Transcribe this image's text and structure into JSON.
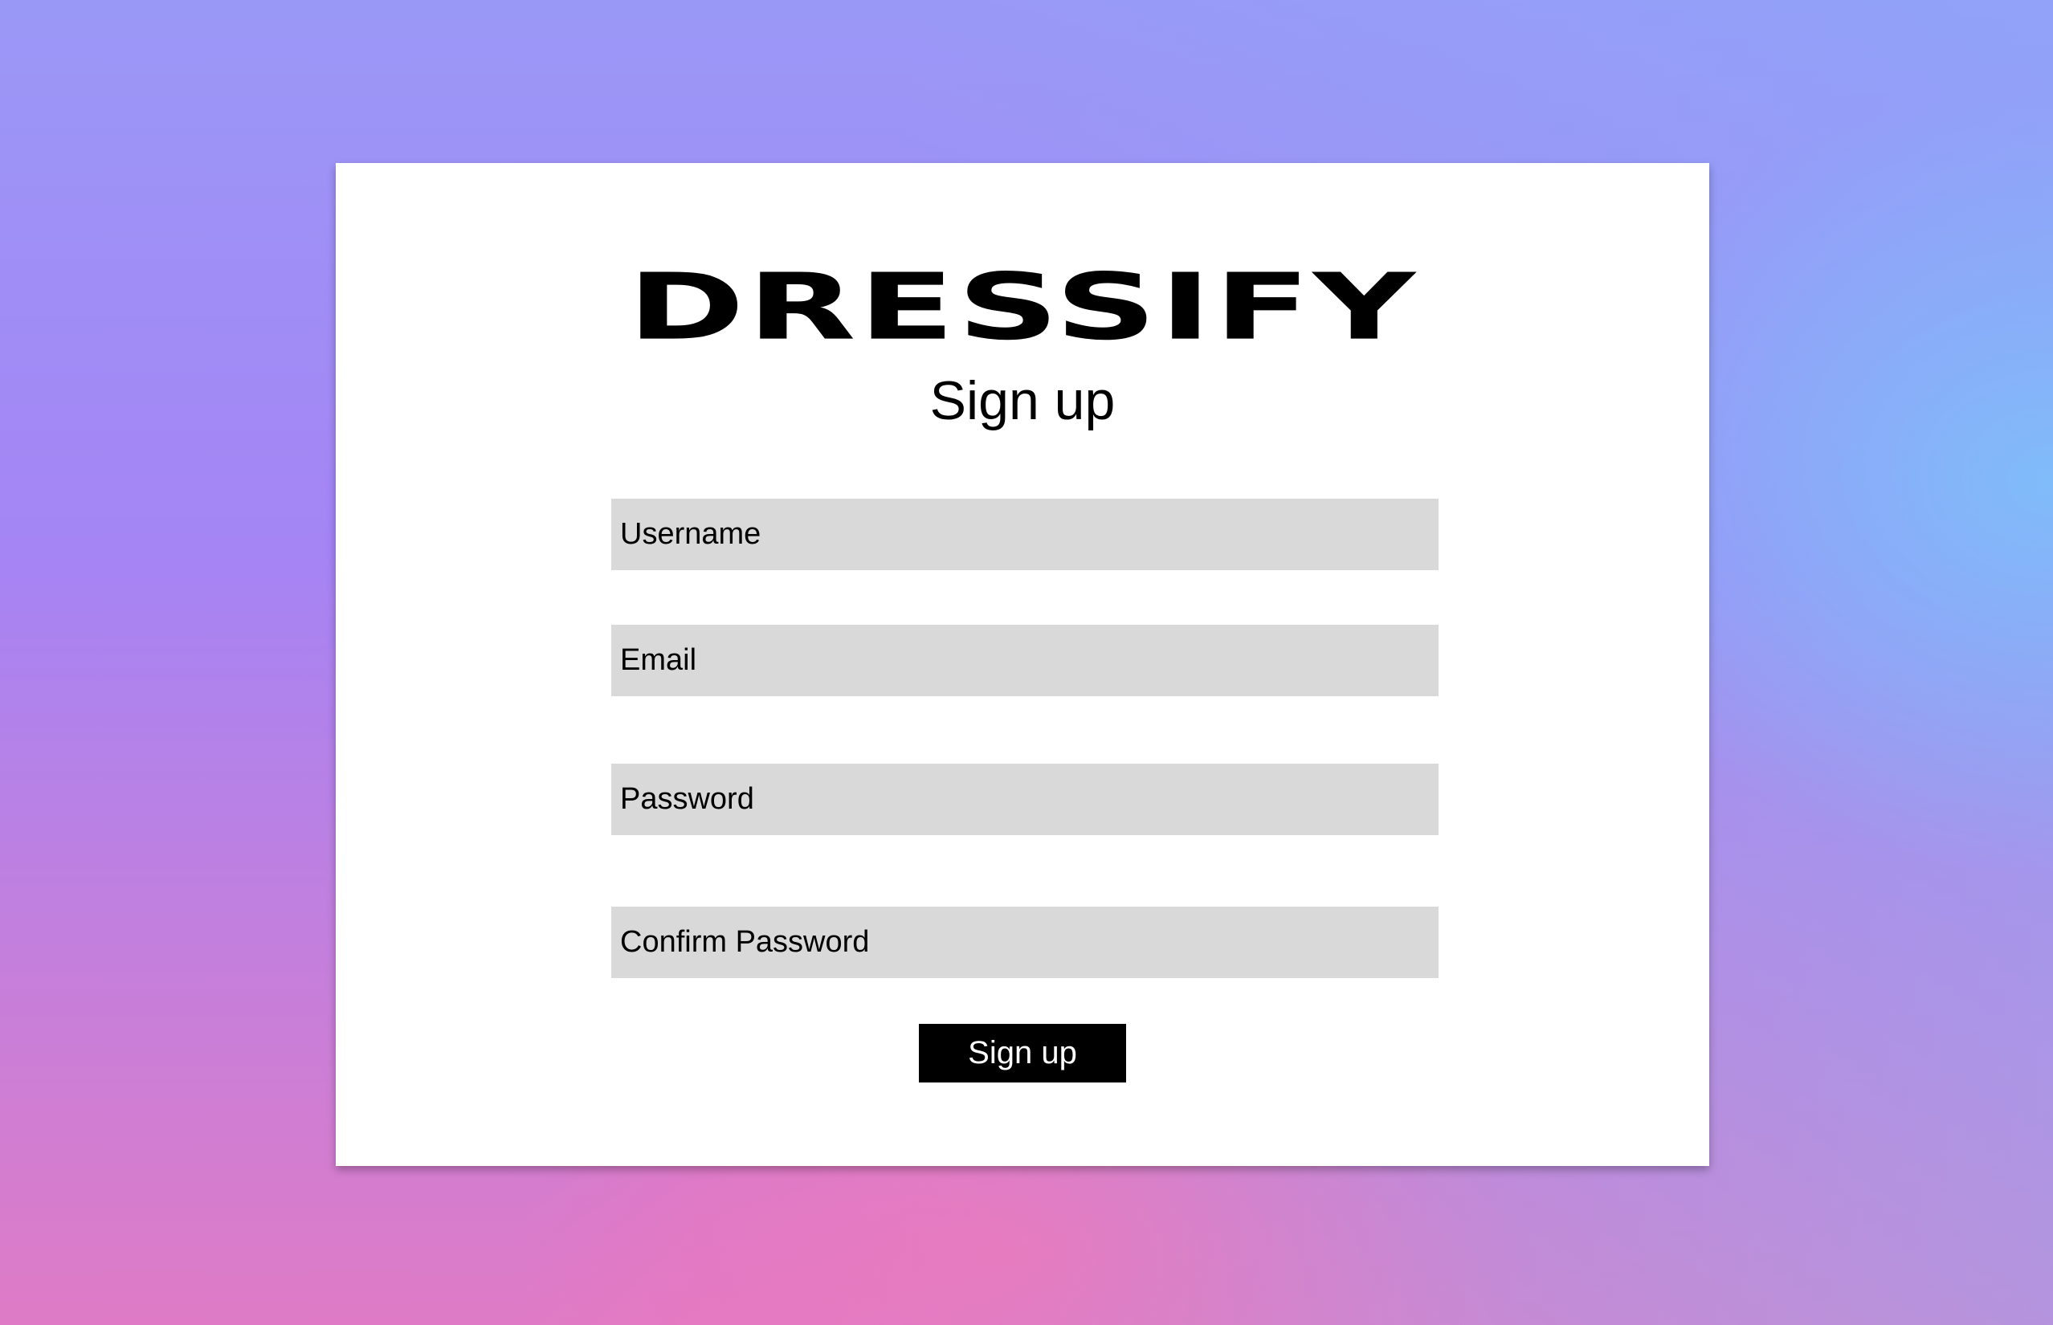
{
  "brand": {
    "name": "DRESSIFY"
  },
  "form": {
    "title": "Sign up",
    "fields": [
      {
        "id": "username",
        "placeholder": "Username",
        "value": ""
      },
      {
        "id": "email",
        "placeholder": "Email",
        "value": ""
      },
      {
        "id": "password",
        "placeholder": "Password",
        "value": ""
      },
      {
        "id": "confirm_password",
        "placeholder": "Confirm Password",
        "value": ""
      }
    ],
    "submit_label": "Sign up"
  },
  "colors": {
    "card_background": "#ffffff",
    "input_background": "#d9d9d9",
    "button_background": "#000000",
    "button_text": "#ffffff",
    "text": "#000000"
  }
}
